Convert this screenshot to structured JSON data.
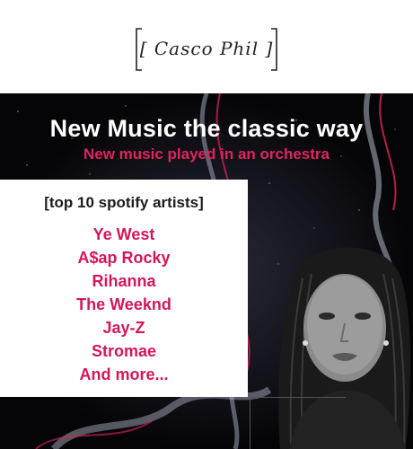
{
  "header": {
    "logo_text": "[ Casco Phil ]"
  },
  "hero": {
    "title": "New Music the classic way",
    "subtitle": "New music played in an orchestra"
  },
  "card": {
    "heading": "[top 10 spotify artists]",
    "artists": [
      "Ye West",
      "A$ap Rocky",
      "Rihanna",
      "The Weeknd",
      "Jay-Z",
      "Stromae",
      "And more..."
    ]
  },
  "colors": {
    "accent": "#d4165c",
    "hero_bg": "#0b0b10",
    "header_bg": "#ffffff"
  },
  "icons": {
    "logo": "casco-phil-logo-icon"
  }
}
